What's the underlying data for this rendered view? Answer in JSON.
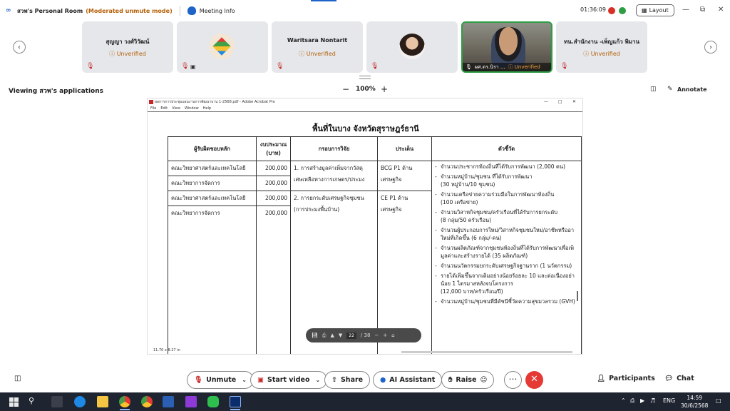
{
  "titlebar": {
    "logo": "∞",
    "title": "สวพ's Personal Room",
    "mode": "(Moderated unmute mode)",
    "meeting_info": "Meeting Info",
    "time": "01:36:09",
    "rec": "0",
    "layout": "Layout",
    "minimize": "—",
    "restore": "⧉",
    "close": "✕"
  },
  "participants_strip": [
    {
      "name": "สุญญา วงศ์วิวัฒน์",
      "status": "ⓘ Unverified"
    },
    {
      "name": "",
      "status": ""
    },
    {
      "name": "Waritsara Nontarit",
      "status": "ⓘ Unverified"
    },
    {
      "name": "",
      "status": ""
    },
    {
      "name": "ผศ.ดร.นิรา ...",
      "status": "ⓘ Unverified"
    },
    {
      "name": "ทน.สำนักงาน -เพ็ญแก้ว พิมาน",
      "status": "ⓘ Unverified"
    }
  ],
  "viewbar": {
    "viewing": "Viewing สวพ's applications",
    "zoom": "100%",
    "annotate": "Annotate"
  },
  "pdf": {
    "window_title": "ผลการการประชุมแผนงานการพัฒนาบาน 1-2568.pdf - Adobe Acrobat Pro",
    "menu": [
      "File",
      "Edit",
      "View",
      "Window",
      "Help"
    ],
    "heading": "พื้นที่ในบาง จังหวัดสุราษฎร์ธานี",
    "headers": {
      "owner": "ผู้รับผิดชอบหลัก",
      "budget": "งบประมาณ (บาท)",
      "framework": "กรอบการวิจัย",
      "issue": "ประเด็น",
      "indicator": "ตัวชี้วัด"
    },
    "rows": [
      {
        "owner": "คณะวิทยาศาสตร์และเทคโนโลยี",
        "budget": "200,000"
      },
      {
        "owner": "คณะวิทยาการจัดการ",
        "budget": "200,000"
      },
      {
        "owner": "คณะวิทยาศาสตร์และเทคโนโลยี",
        "budget": "200,000"
      },
      {
        "owner": "คณะวิทยาการจัดการ",
        "budget": "200,000"
      }
    ],
    "framework_1a": "1. การสร้างมูลค่าเพิ่มจากวัสดุ",
    "framework_1b": "เศษเหลือทางการเกษตร/ประมง",
    "framework_2a": "2. การยกระดับเศรษฐกิจชุมชน",
    "framework_2b": "(การประมงพื้นบ้าน)",
    "issue_1": "BCG P1 ด้านเศรษฐกิจ",
    "issue_2": "CE P1 ด้านเศรษฐกิจ",
    "indicators": [
      [
        "จำนวนประชากรท้องถิ่นที่ได้รับการพัฒนา (2,000 คน)",
        ""
      ],
      [
        "จำนวนหมู่บ้าน/ชุมชน ที่ได้รับการพัฒนา",
        "(30 หมู่บ้าน/10 ชุมชน)"
      ],
      [
        "จำนวนเครือข่ายความร่วมมือในการพัฒนาท้องถิ่น",
        "(100 เครือข่าย)"
      ],
      [
        "จำนวนวิสาหกิจชุมชน/ครัวเรือนที่ได้รับการยกระดับ",
        "(8 กลุ่ม/50 ครัวเรือน)"
      ],
      [
        "จำนวนผู้ประกอบการใหม่/วิสาหกิจชุมชนใหม่/อาชีพหรืออา",
        "ใหม่ที่เกิดขึ้น (6 กลุ่ม/-คน)"
      ],
      [
        "จำนวนผลิตภัณฑ์จากชุมชนท้องถิ่นที่ได้รับการพัฒนาเพื่อเพิ",
        "มูลค่าและสร้างรายได้ (35 ผลิตภัณฑ์)"
      ],
      [
        "จำนวนนวัตกรรมยกระดับเศรษฐกิจฐานราก (1 นวัตกรรม)",
        ""
      ],
      [
        "รายได้เพิ่มขึ้นจากเดิมอย่างน้อยร้อยละ 10 และต่อเนื่องอย่า",
        "น้อย 1 ไตรมาสหลังจบโครงการ",
        "(12,000 บาท/ครัวเรือน/ปี)"
      ],
      [
        "จำนวนหมู่บ้าน/ชุมชนที่มีดัชนีชี้วัดความสุขมวลรวม (GVH)",
        ""
      ]
    ],
    "page_size": "11.70 x 8.27 in",
    "page_current": "22",
    "page_total": "/ 38"
  },
  "controls": {
    "unmute": "Unmute",
    "start_video": "Start video",
    "share": "Share",
    "ai_assistant": "AI Assistant",
    "raise": "Raise",
    "more": "⋯",
    "leave": "✕",
    "participants": "Participants",
    "chat": "Chat"
  },
  "taskbar": {
    "lang": "ENG",
    "time": "14:59",
    "date": "30/6/2568"
  },
  "colors": {
    "accent": "#1e63c8",
    "unverified": "#b45f06",
    "leave": "#e53935",
    "muted": "#c62828"
  }
}
